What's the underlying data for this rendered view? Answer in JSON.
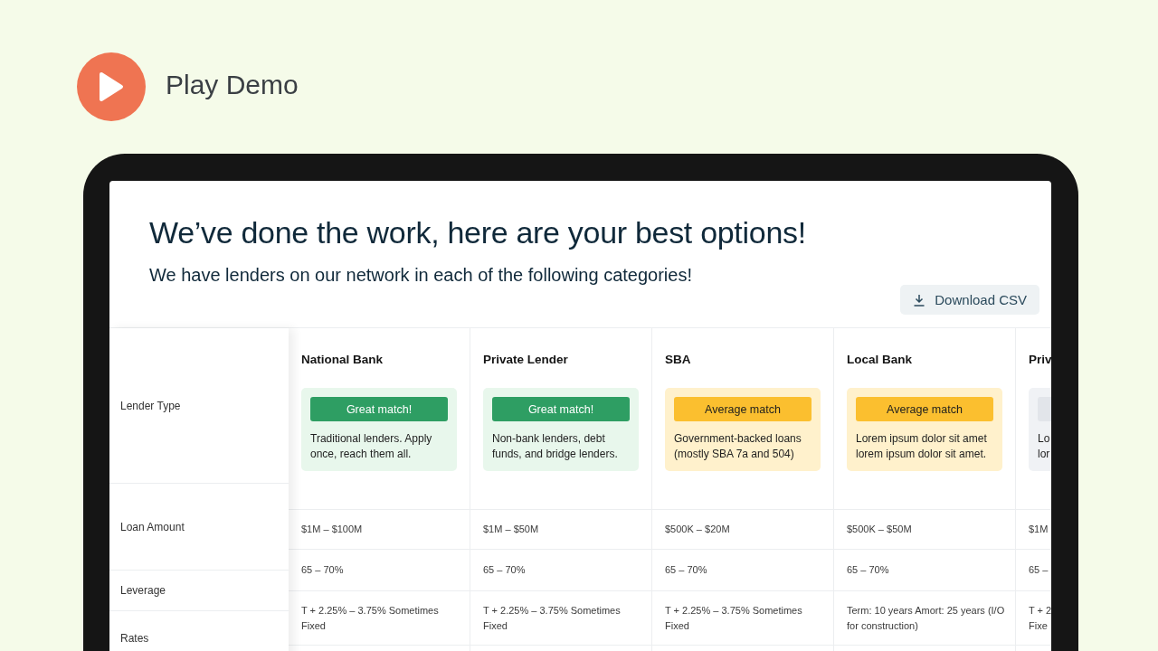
{
  "demo": {
    "label": "Play Demo"
  },
  "page": {
    "title": "We’ve done the work, here are your best options!",
    "subtitle": "We have lenders on our network in each of the following categories!",
    "download_button": "Download CSV"
  },
  "row_labels": [
    "Lender Type",
    "Loan Amount",
    "Leverage",
    "Rates"
  ],
  "lenders": [
    {
      "name": "National Bank",
      "match": {
        "kind": "great",
        "label": "Great match!"
      },
      "description": "Traditional lenders. Apply once, reach them all.",
      "loan_amount": "$1M – $100M",
      "leverage": "65 – 70%",
      "rates": "T + 2.25% – 3.75% Sometimes Fixed"
    },
    {
      "name": "Private Lender",
      "match": {
        "kind": "great",
        "label": "Great match!"
      },
      "description": "Non-bank lenders, debt funds, and bridge lenders.",
      "loan_amount": "$1M – $50M",
      "leverage": "65 – 70%",
      "rates": "T + 2.25% – 3.75% Sometimes Fixed"
    },
    {
      "name": "SBA",
      "match": {
        "kind": "average",
        "label": "Average match"
      },
      "description": "Government-backed loans (mostly SBA 7a and 504)",
      "loan_amount": "$500K – $20M",
      "leverage": "65 – 70%",
      "rates": "T + 2.25% – 3.75% Sometimes Fixed"
    },
    {
      "name": "Local Bank",
      "match": {
        "kind": "average",
        "label": "Average match"
      },
      "description": "Lorem ipsum dolor sit amet lorem ipsum dolor sit amet.",
      "loan_amount": "$500K – $50M",
      "leverage": "65 – 70%",
      "rates": "Term: 10 years Amort: 25 years (I/O for construction)"
    },
    {
      "name": "Priv",
      "match": {
        "kind": "neutral"
      },
      "description": "Lo\nlor",
      "loan_amount": "$1M",
      "leverage": "65 –",
      "rates": "T + 2\nFixe"
    }
  ]
}
